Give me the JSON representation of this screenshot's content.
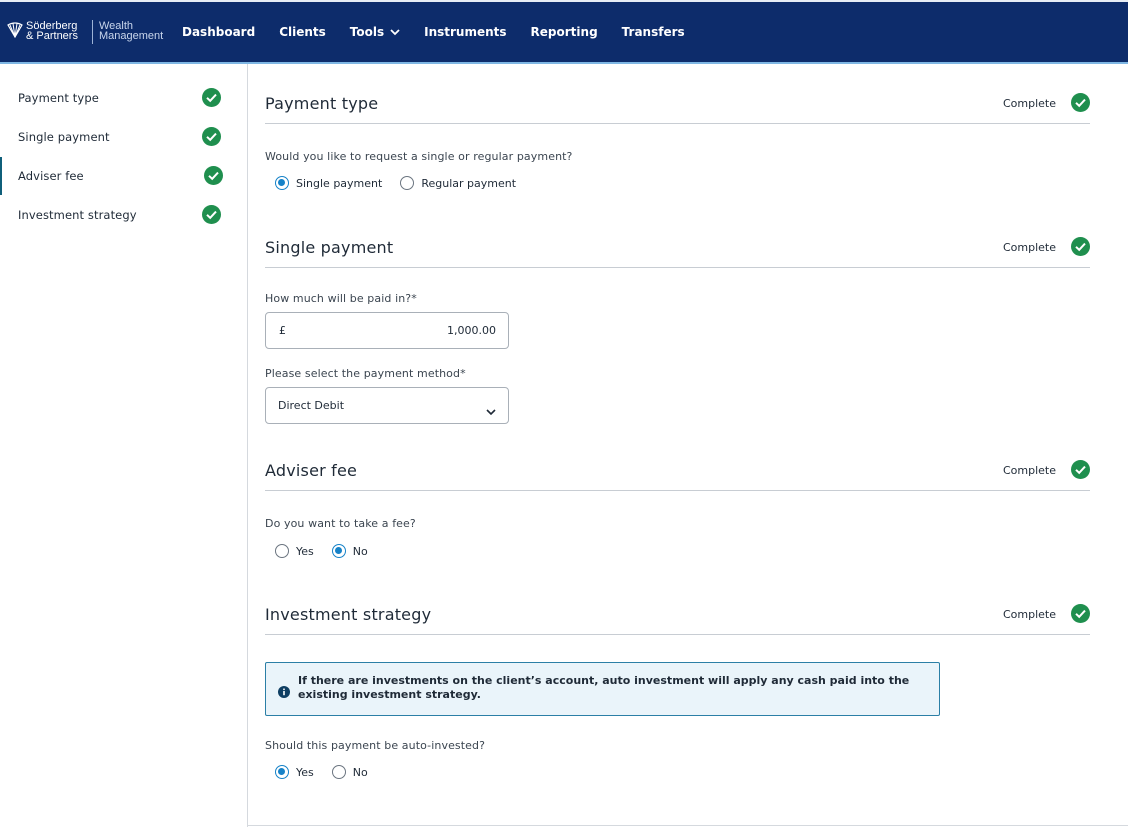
{
  "brand": {
    "firm_line1": "Söderberg",
    "firm_line2": "& Partners",
    "sub_line1": "Wealth",
    "sub_line2": "Management"
  },
  "nav": {
    "items": [
      {
        "label": "Dashboard"
      },
      {
        "label": "Clients"
      },
      {
        "label": "Tools"
      },
      {
        "label": "Instruments"
      },
      {
        "label": "Reporting"
      },
      {
        "label": "Transfers"
      }
    ]
  },
  "sidebar": {
    "items": [
      {
        "label": "Payment type",
        "status": "complete"
      },
      {
        "label": "Single payment",
        "status": "complete"
      },
      {
        "label": "Adviser fee",
        "status": "complete",
        "active": true
      },
      {
        "label": "Investment strategy",
        "status": "complete"
      }
    ]
  },
  "sections": {
    "payment_type": {
      "title": "Payment type",
      "status": "Complete",
      "question": "Would you like to request a single or regular payment?",
      "options": [
        "Single payment",
        "Regular payment"
      ],
      "selected": "Single payment"
    },
    "single_payment": {
      "title": "Single payment",
      "status": "Complete",
      "amount_label": "How much will be paid in?",
      "amount_required": "*",
      "currency_symbol": "£",
      "amount_value": "1,000.00",
      "method_label": "Please select the payment method",
      "method_required": "*",
      "method_value": "Direct Debit"
    },
    "adviser_fee": {
      "title": "Adviser fee",
      "status": "Complete",
      "question": "Do you want to take a fee?",
      "options": [
        "Yes",
        "No"
      ],
      "selected": "No"
    },
    "investment_strategy": {
      "title": "Investment strategy",
      "status": "Complete",
      "info_text": "If there are investments on the client’s account, auto investment will apply any cash paid into the existing investment strategy.",
      "question": "Should this payment be auto-invested?",
      "options": [
        "Yes",
        "No"
      ],
      "selected": "Yes"
    }
  },
  "colors": {
    "header_bg": "#0d2c6b",
    "success_green": "#1f8f4e",
    "radio_blue": "#1682c8",
    "info_border": "#2b7fa6",
    "info_bg": "#eaf4fa"
  }
}
